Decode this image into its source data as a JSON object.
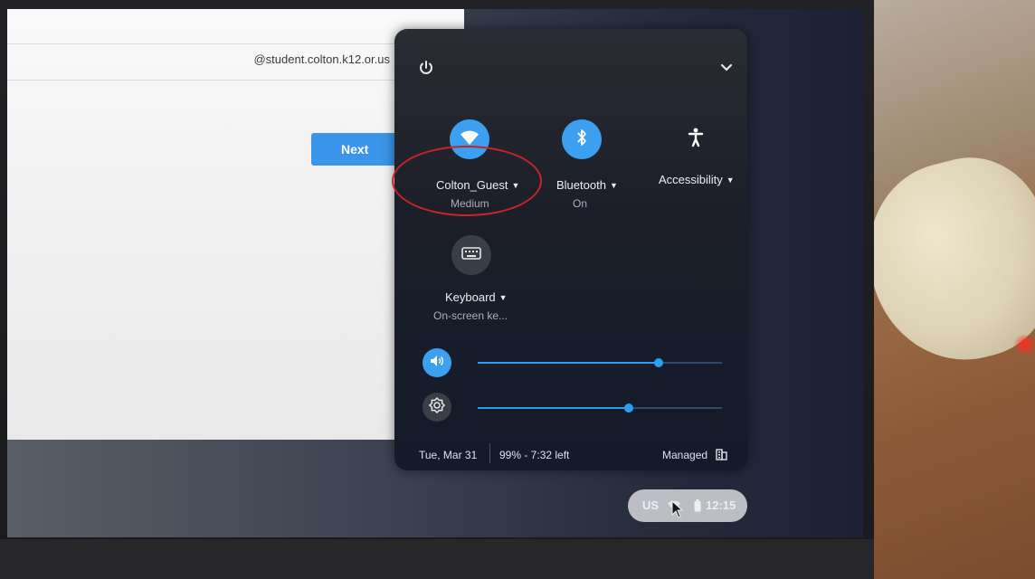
{
  "signin_page": {
    "domain_suffix": "@student.colton.k12.or.us",
    "next_label": "Next"
  },
  "quick_settings": {
    "network": {
      "label": "Colton_Guest",
      "sublabel": "Medium",
      "state": "on"
    },
    "bluetooth": {
      "label": "Bluetooth",
      "sublabel": "On",
      "state": "on"
    },
    "accessibility": {
      "label": "Accessibility"
    },
    "keyboard": {
      "label": "Keyboard",
      "sublabel": "On-screen ke..."
    },
    "volume_level": 0.74,
    "brightness_level": 0.62,
    "date": "Tue, Mar 31",
    "battery": "99% - 7:32 left",
    "managed_label": "Managed"
  },
  "tray": {
    "input_method": "US",
    "time": "12:15"
  },
  "colors": {
    "accent": "#3d9fef",
    "panel": "#1c1f29",
    "annotation": "#c6232a"
  },
  "icons": [
    "power-icon",
    "collapse-chevron-icon",
    "wifi-icon",
    "bluetooth-icon",
    "accessibility-icon",
    "keyboard-icon",
    "volume-icon",
    "brightness-icon",
    "managed-building-icon",
    "wifi-status-icon",
    "battery-icon",
    "cursor-icon"
  ]
}
